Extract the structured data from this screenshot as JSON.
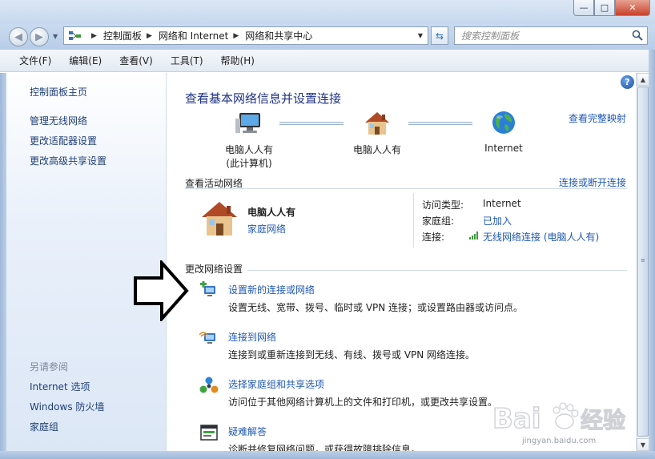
{
  "window": {
    "minimize_label": "—",
    "maximize_label": "□",
    "close_label": "✕"
  },
  "navigation": {
    "back_icon": "◀",
    "forward_icon": "▶",
    "refresh_icon": "⇆",
    "breadcrumb": [
      "控制面板",
      "网络和 Internet",
      "网络和共享中心"
    ],
    "search_placeholder": "搜索控制面板"
  },
  "menu": {
    "items": [
      "文件(F)",
      "编辑(E)",
      "查看(V)",
      "工具(T)",
      "帮助(H)"
    ]
  },
  "sidebar": {
    "home_link": "控制面板主页",
    "links": [
      "管理无线网络",
      "更改适配器设置",
      "更改高级共享设置"
    ],
    "see_also_heading": "另请参阅",
    "see_also": [
      "Internet 选项",
      "Windows 防火墙",
      "家庭组"
    ]
  },
  "main": {
    "help_label": "?",
    "title": "查看基本网络信息并设置连接",
    "full_map_link": "查看完整映射",
    "nodes": [
      {
        "line1": "电脑人人有",
        "line2": "(此计算机)"
      },
      {
        "line1": "电脑人人有",
        "line2": ""
      },
      {
        "line1": "Internet",
        "line2": ""
      }
    ],
    "active_networks": {
      "section_title": "查看活动网络",
      "connect_link": "连接或断开连接",
      "network_name": "电脑人人有",
      "network_type": "家庭网络",
      "access_type_label": "访问类型:",
      "access_type_value": "Internet",
      "homegroup_label": "家庭组:",
      "homegroup_value": "已加入",
      "connection_label": "连接:",
      "connection_value": "无线网络连接 (电脑人人有)"
    },
    "change_settings": {
      "section_title": "更改网络设置",
      "tasks": [
        {
          "title": "设置新的连接或网络",
          "description": "设置无线、宽带、拨号、临时或 VPN 连接；或设置路由器或访问点。"
        },
        {
          "title": "连接到网络",
          "description": "连接到或重新连接到无线、有线、拨号或 VPN 网络连接。"
        },
        {
          "title": "选择家庭组和共享选项",
          "description": "访问位于其他网络计算机上的文件和打印机，或更改共享设置。"
        },
        {
          "title": "疑难解答",
          "description": "诊断并修复网络问题，或获得故障排除信息。"
        }
      ]
    }
  },
  "scrollbar": {
    "up_icon": "▲",
    "down_icon": "▼"
  },
  "watermark": {
    "url": "jingyan.baidu.com"
  },
  "colors": {
    "link": "#2058b6",
    "title": "#1e3287",
    "sidebar_link": "#1e3f75"
  }
}
